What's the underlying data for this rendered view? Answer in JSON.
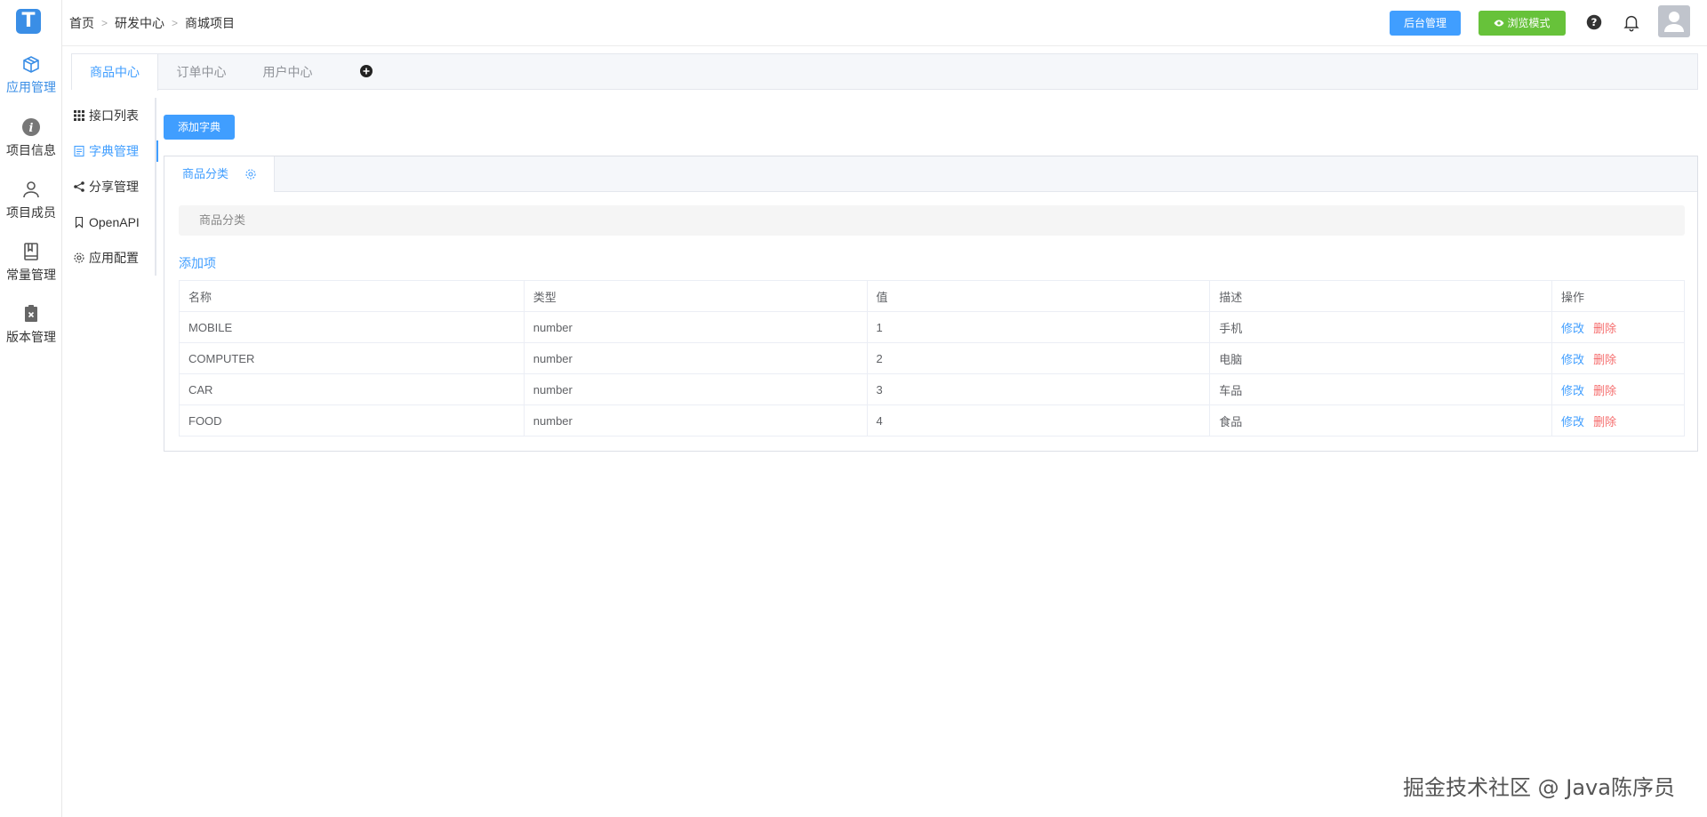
{
  "logo": "T",
  "rail": {
    "items": [
      {
        "label": "应用管理",
        "icon": "package-icon",
        "active": true
      },
      {
        "label": "项目信息",
        "icon": "info-icon",
        "active": false
      },
      {
        "label": "项目成员",
        "icon": "user-icon",
        "active": false
      },
      {
        "label": "常量管理",
        "icon": "book-icon",
        "active": false
      },
      {
        "label": "版本管理",
        "icon": "clipboard-icon",
        "active": false
      }
    ]
  },
  "breadcrumb": [
    "首页",
    "研发中心",
    "商城项目"
  ],
  "header": {
    "admin_label": "后台管理",
    "preview_label": "浏览模式"
  },
  "top_tabs": [
    "商品中心",
    "订单中心",
    "用户中心"
  ],
  "submenu": [
    "接口列表",
    "字典管理",
    "分享管理",
    "OpenAPI",
    "应用配置"
  ],
  "content": {
    "add_dict_label": "添加字典",
    "dict_tab": "商品分类",
    "dict_desc": "商品分类",
    "add_item_label": "添加项",
    "table": {
      "headers": [
        "名称",
        "类型",
        "值",
        "描述",
        "操作"
      ],
      "rows": [
        {
          "name": "MOBILE",
          "type": "number",
          "value": "1",
          "desc": "手机"
        },
        {
          "name": "COMPUTER",
          "type": "number",
          "value": "2",
          "desc": "电脑"
        },
        {
          "name": "CAR",
          "type": "number",
          "value": "3",
          "desc": "车品"
        },
        {
          "name": "FOOD",
          "type": "number",
          "value": "4",
          "desc": "食品"
        }
      ],
      "edit_label": "修改",
      "delete_label": "删除"
    }
  },
  "watermark": "掘金技术社区 @ Java陈序员",
  "colors": {
    "primary": "#409eff",
    "success": "#67c23a",
    "danger": "#f56c6c"
  }
}
